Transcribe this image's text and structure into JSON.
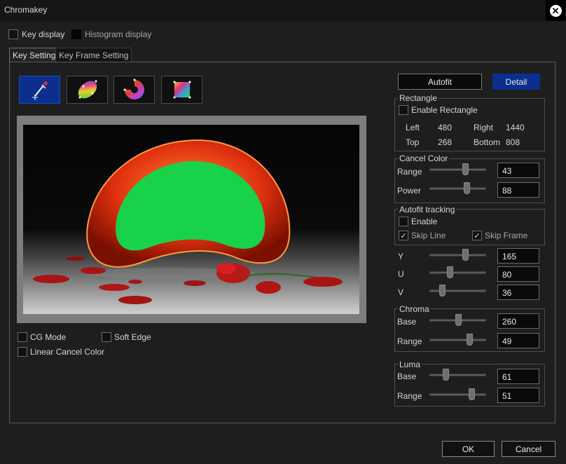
{
  "window": {
    "title": "Chromakey"
  },
  "top_options": {
    "key_display": "Key display",
    "histogram_display": "Histogram display"
  },
  "tabs": [
    {
      "label": "Key Setting"
    },
    {
      "label": "Key Frame Setting"
    }
  ],
  "buttons": {
    "autofit": "Autofit",
    "detail": "Detail",
    "ok": "OK",
    "cancel": "Cancel"
  },
  "rectangle": {
    "title": "Rectangle",
    "enable": "Enable Rectangle",
    "left_label": "Left",
    "left": "480",
    "right_label": "Right",
    "right": "1440",
    "top_label": "Top",
    "top": "268",
    "bottom_label": "Bottom",
    "bottom": "808"
  },
  "cancel_color": {
    "title": "Cancel Color",
    "range_label": "Range",
    "range": "43",
    "power_label": "Power",
    "power": "88"
  },
  "autofit_tracking": {
    "title": "Autofit tracking",
    "enable": "Enable",
    "skip_line": "Skip Line",
    "skip_frame": "Skip Frame"
  },
  "yuv": {
    "y_label": "Y",
    "y": "165",
    "u_label": "U",
    "u": "80",
    "v_label": "V",
    "v": "36"
  },
  "chroma": {
    "title": "Chroma",
    "base_label": "Base",
    "base": "260",
    "range_label": "Range",
    "range": "49"
  },
  "luma": {
    "title": "Luma",
    "base_label": "Base",
    "base": "61",
    "range_label": "Range",
    "range": "51"
  },
  "bottom_options": {
    "cg_mode": "CG Mode",
    "soft_edge": "Soft Edge",
    "linear_cancel": "Linear Cancel Color"
  },
  "colors": {
    "accent_blue": "#0c2f8e",
    "key_green": "#18d24a",
    "panel_bg": "#1e1e1e"
  },
  "slider_levels": {
    "cancel_range": 0.65,
    "cancel_power": 0.68,
    "y": 0.65,
    "u": 0.35,
    "v": 0.2,
    "chroma_base": 0.52,
    "chroma_range": 0.74,
    "luma_base": 0.27,
    "luma_range": 0.78
  }
}
